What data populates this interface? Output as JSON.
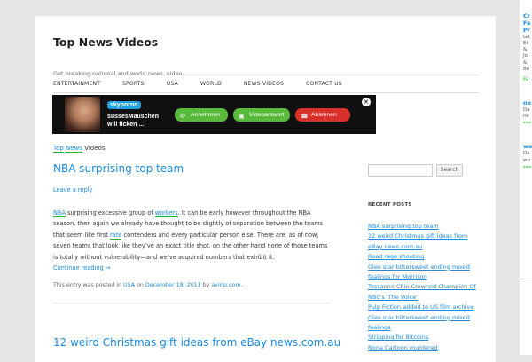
{
  "site": {
    "title": "Top News Videos",
    "description": "Get breaking national and world news, video"
  },
  "nav": [
    "ENTERTAINMENT",
    "SPORTS",
    "USA",
    "WORLD",
    "NEWS VIDEOS",
    "CONTACT US"
  ],
  "ad": {
    "brand": "skyporno",
    "line1": "süssesMäuschen",
    "line2": "will ficken ...",
    "accept": "Annehmen",
    "video": "Videoantwort",
    "decline": "Ablehnen",
    "close": "×"
  },
  "breadcrumb": {
    "link_top": "Top",
    "link_news": "News",
    "rest": "Videos"
  },
  "post1": {
    "title": "NBA surprising top team",
    "reply": "Leave a reply",
    "kw_nba": "NBA",
    "t1": " surprising excessive group of ",
    "kw_workers": "workers",
    "t2": ". It can be early however throughout the NBA season, then again we already have thought to be slightly of separation between the teams that seem like first ",
    "kw_rate": "rate",
    "t3": " contenders and every particular person else. There are, as of now, seven teams that look like they’ve an exact title shot, on the other hand none of those teams is totally without vulnerability—and we’ve acquired numbers that exhibit it.",
    "more": "Continue reading →",
    "meta_prefix": "This entry was posted in ",
    "meta_category": "USA",
    "meta_on": " on ",
    "meta_date": "December 19, 2013",
    "meta_by": " by ",
    "meta_author": "avirip.com",
    "meta_end": "."
  },
  "post2": {
    "title": "12 weird Christmas gift ideas from eBay news.com.au"
  },
  "sidebar": {
    "search_placeholder": "",
    "search_button": "Search",
    "recent_title": "RECENT POSTS",
    "recent": [
      "NBA surprising top team",
      "12 weird Christmas gift ideas from",
      "eBay news.com.au",
      "Road rage shooting",
      "Glee star bittersweet ending mixed",
      "fealings for Morrison",
      "Tessanne Chin Crowned Champion Of",
      "NBC's 'The Voice'",
      "Pulp Fiction added to US film archive",
      "Glee star bittersweet ending mixed",
      "fealings",
      "Stripping for Bitcoins",
      "Nona Cartoon murdered"
    ]
  },
  "side": {
    "t1": "Cr",
    "t2": "Fa",
    "t3": "Pr",
    "s1": "Ge",
    "s2": "Eli",
    "s3": "&",
    "s4": "Jo",
    "s5": "&",
    "s6": "Be",
    "g1": "Fa",
    "t4": "ne",
    "s7": "Da",
    "s8": "ne",
    "g2": "***",
    "t5": "we",
    "s9": "Da",
    "s10": "wo",
    "g3": "***"
  },
  "colors": {
    "link": "#1b8be0",
    "underline": "#22bb22",
    "accept": "#58b93a",
    "decline": "#d8302a"
  }
}
